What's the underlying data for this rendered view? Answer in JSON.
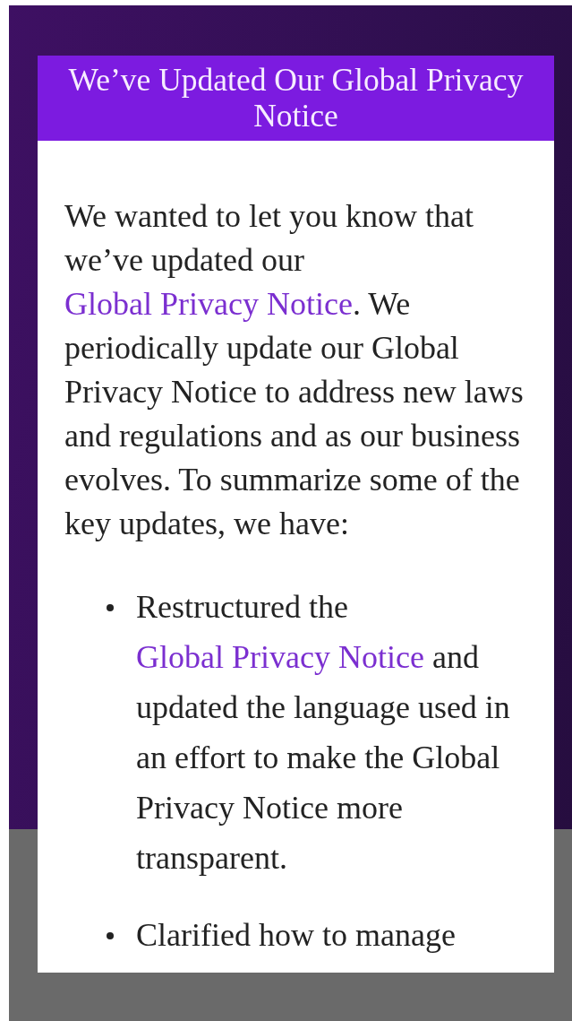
{
  "dialog": {
    "title": "We’ve Updated Our Global Privacy Notice",
    "intro": [
      {
        "kind": "text",
        "text": "We wanted to let you know that we’ve updated our "
      },
      {
        "kind": "link",
        "text": "Global Privacy Notice"
      },
      {
        "kind": "text",
        "text": ". We periodically update our Global Privacy Notice to address new laws and regulations and as our business evolves. To summarize some of the key updates, we have:"
      }
    ],
    "bullets": [
      [
        {
          "kind": "text",
          "text": "Restructured the "
        },
        {
          "kind": "link",
          "text": "Global Privacy Notice"
        },
        {
          "kind": "text",
          "text": " and updated the language used in an effort to make the Global Privacy Notice more transparent."
        }
      ],
      [
        {
          "kind": "text",
          "text": "Clarified how to manage"
        }
      ]
    ]
  }
}
